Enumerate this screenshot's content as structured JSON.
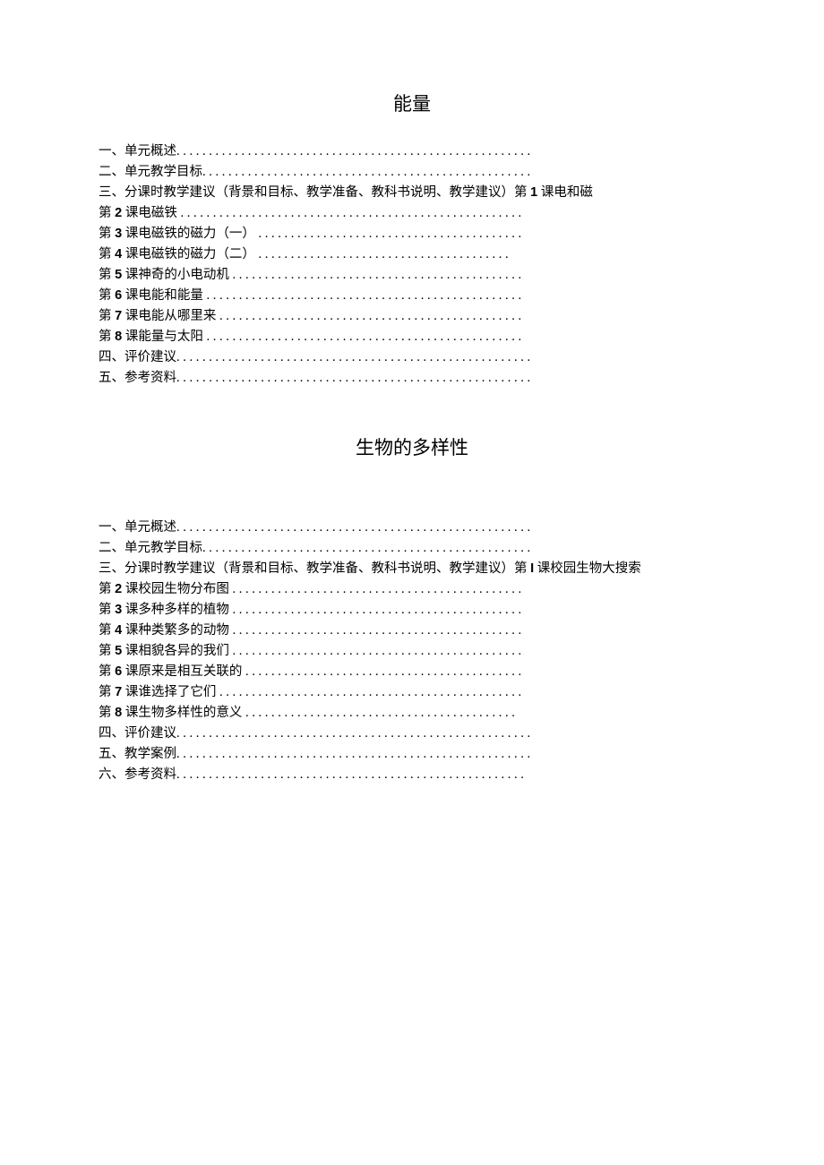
{
  "section1": {
    "title": "能量",
    "lines": [
      {
        "pre": "一、单元概述",
        "num": "",
        "post": "",
        "dots": ". . . . . . . . . . . . . . . . . . . . . . . . . . . . . . . . . . . . . . . . . . . . . . . . . . . . . . ."
      },
      {
        "pre": "二、单元教学目标",
        "num": "",
        "post": "",
        "dots": ". . . . . . . . . . . . . . . . . . . . . . . . . . . . . . . . . . . . . . . . . . . . . . . . . . ."
      },
      {
        "pre": "三、分课时教学建议（背景和目标、教学准备、教科书说明、教学建议）第 ",
        "num": "1",
        "post": " 课电和磁",
        "dots": ""
      },
      {
        "pre": "第 ",
        "num": "2",
        "post": " 课电磁铁 ",
        "dots": " . . . . . . . . . . . . . . . . . . . . . . . . . . . . . . . . . . . . . . . . . . . . . . . . . . . . ."
      },
      {
        "pre": "第 ",
        "num": "3",
        "post": " 课电磁铁的磁力（一）  ",
        "dots": ". . . . . . . . . . . . . . . . . . . . . . . . . . . . . . . . . . . . . . . . ."
      },
      {
        "pre": "第 ",
        "num": "4",
        "post": " 课电磁铁的磁力（二）  ",
        "dots": ". . . . . . . . . . . . . . . . . . . . . . . . . . . . . . . . . . . . . . ."
      },
      {
        "pre": "第 ",
        "num": "5",
        "post": " 课神奇的小电动机  ",
        "dots": ". . . . . . . . . . . . . . . . . . . . . . . . . . . . . . . . . . . . . . . . . . . . ."
      },
      {
        "pre": "第 ",
        "num": "6",
        "post": " 课电能和能量  ",
        "dots": ". . . . . . . . . . . . . . . . . . . . . . . . . . . . . . . . . . . . . . . . . . . . . . . . ."
      },
      {
        "pre": "第 ",
        "num": "7",
        "post": " 课电能从哪里来  ",
        "dots": ". . . . . . . . . . . . . . . . . . . . . . . . . . . . . . . . . . . . . . . . . . . . . . ."
      },
      {
        "pre": "第 ",
        "num": "8",
        "post": " 课能量与太阳  ",
        "dots": ". . . . . . . . . . . . . . . . . . . . . . . . . . . . . . . . . . . . . . . . . . . . . . . . ."
      },
      {
        "pre": "四、评价建议",
        "num": "",
        "post": "",
        "dots": ". . . . . . . . . . . . . . . . . . . . . . . . . . . . . . . . . . . . . . . . . . . . . . . . . . . . . . ."
      },
      {
        "pre": "五、参考资料",
        "num": "",
        "post": "",
        "dots": ". . . . . . . . . . . . . . . . . . . . . . . . . . . . . . . . . . . . . . . . . . . . . . . . . . . . . . ."
      }
    ]
  },
  "section2": {
    "title": "生物的多样性",
    "lines": [
      {
        "pre": "一、单元概述",
        "num": "",
        "post": "",
        "dots": ". . . . . . . . . . . . . . . . . . . . . . . . . . . . . . . . . . . . . . . . . . . . . . . . . . . . . . ."
      },
      {
        "pre": "二、单元教学目标",
        "num": "",
        "post": "",
        "dots": ". . . . . . . . . . . . . . . . . . . . . . . . . . . . . . . . . . . . . . . . . . . . . . . . . . ."
      },
      {
        "pre": "三、分课时教学建议（背景和目标、教学准备、教科书说明、教学建议）第 ",
        "num": "I",
        "post": " 课校园生物大搜索",
        "dots": ""
      },
      {
        "pre": "第 ",
        "num": "2",
        "post": " 课校园生物分布图  ",
        "dots": ". . . . . . . . . . . . . . . . . . . . . . . . . . . . . . . . . . . . . . . . . . . . ."
      },
      {
        "pre": "第 ",
        "num": "3",
        "post": " 课多种多样的植物  ",
        "dots": ". . . . . . . . . . . . . . . . . . . . . . . . . . . . . . . . . . . . . . . . . . . . ."
      },
      {
        "pre": "第 ",
        "num": "4",
        "post": " 课种类繁多的动物  ",
        "dots": ". . . . . . . . . . . . . . . . . . . . . . . . . . . . . . . . . . . . . . . . . . . . ."
      },
      {
        "pre": "第 ",
        "num": "5",
        "post": " 课相貌各异的我们  ",
        "dots": ". . . . . . . . . . . . . . . . . . . . . . . . . . . . . . . . . . . . . . . . . . . . ."
      },
      {
        "pre": "第 ",
        "num": "6",
        "post": " 课原来是相互关联的  ",
        "dots": ". . . . . . . . . . . . . . . . . . . . . . . . . . . . . . . . . . . . . . . . . . ."
      },
      {
        "pre": "第 ",
        "num": "7",
        "post": " 课谁选择了它们  ",
        "dots": ". . . . . . . . . . . . . . . . . . . . . . . . . . . . . . . . . . . . . . . . . . . . . . ."
      },
      {
        "pre": "第 ",
        "num": "8",
        "post": " 课生物多样性的意义  ",
        "dots": ". . . . . . . . . . . . . . . . . . . . . . . . . . . . . . . . . . . . . . . . . ."
      },
      {
        "pre": "四、评价建议",
        "num": "",
        "post": "",
        "dots": ". . . . . . . . . . . . . . . . . . . . . . . . . . . . . . . . . . . . . . . . . . . . . . . . . . . . . . ."
      },
      {
        "pre": "五、教学案例",
        "num": "",
        "post": "",
        "dots": ". . . . . . . . . . . . . . . . . . . . . . . . . . . . . . . . . . . . . . . . . . . . . . . . . . . . . . ."
      },
      {
        "pre": "六、参考资料",
        "num": "",
        "post": "",
        "dots": ". . . . . . . . . . . . . . . . . . . . . . . . . . . . . . . . . . . . . . . . . . . . . . . . . . . . . ."
      }
    ]
  }
}
